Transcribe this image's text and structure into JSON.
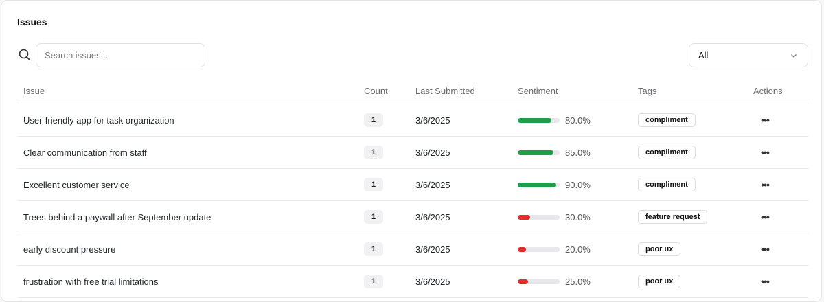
{
  "title": "Issues",
  "search": {
    "placeholder": "Search issues...",
    "value": ""
  },
  "filter": {
    "value": "All"
  },
  "columns": {
    "issue": "Issue",
    "count": "Count",
    "last_submitted": "Last Submitted",
    "sentiment": "Sentiment",
    "tags": "Tags",
    "actions": "Actions"
  },
  "colors": {
    "positive": "#1e9e48",
    "negative": "#e02d2d",
    "track": "#e8e8ec"
  },
  "icons": {
    "search": "search-icon",
    "filter": "chevron-down-icon",
    "row_actions": "more-horizontal-icon"
  },
  "rows": [
    {
      "issue": "User-friendly app for task organization",
      "count": "1",
      "date": "3/6/2025",
      "sentiment": 0.8,
      "sentiment_label": "80.0%",
      "tag": "compliment"
    },
    {
      "issue": "Clear communication from staff",
      "count": "1",
      "date": "3/6/2025",
      "sentiment": 0.85,
      "sentiment_label": "85.0%",
      "tag": "compliment"
    },
    {
      "issue": "Excellent customer service",
      "count": "1",
      "date": "3/6/2025",
      "sentiment": 0.9,
      "sentiment_label": "90.0%",
      "tag": "compliment"
    },
    {
      "issue": "Trees behind a paywall after September update",
      "count": "1",
      "date": "3/6/2025",
      "sentiment": 0.3,
      "sentiment_label": "30.0%",
      "tag": "feature request"
    },
    {
      "issue": "early discount pressure",
      "count": "1",
      "date": "3/6/2025",
      "sentiment": 0.2,
      "sentiment_label": "20.0%",
      "tag": "poor ux"
    },
    {
      "issue": "frustration with free trial limitations",
      "count": "1",
      "date": "3/6/2025",
      "sentiment": 0.25,
      "sentiment_label": "25.0%",
      "tag": "poor ux"
    }
  ]
}
